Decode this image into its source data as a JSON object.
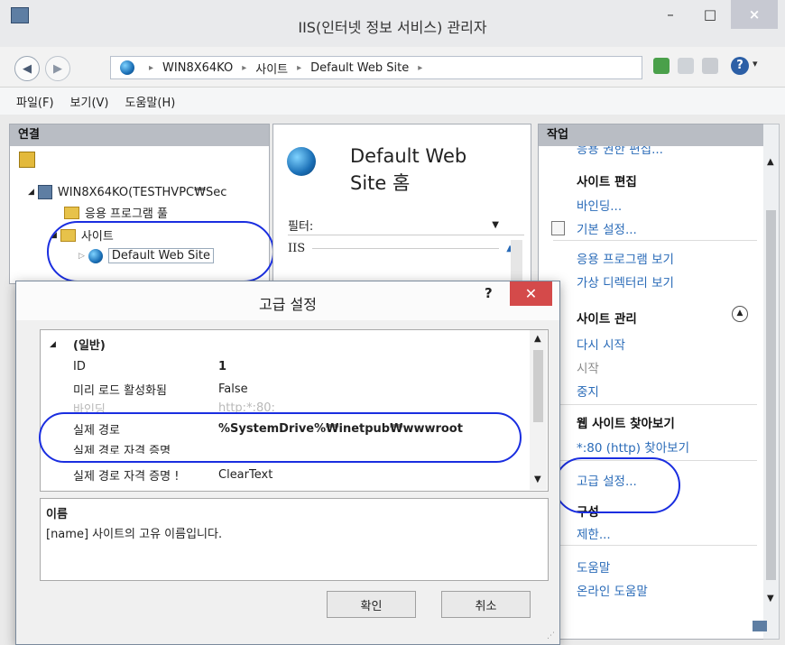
{
  "window": {
    "title": "IIS(인터넷 정보 서비스) 관리자",
    "minimize": "–",
    "maximize": "□",
    "close": "×"
  },
  "address": {
    "crumbs": [
      "WIN8X64KO",
      "사이트",
      "Default Web Site"
    ],
    "sep": "▸"
  },
  "menu": {
    "items": [
      "파일(F)",
      "보기(V)",
      "도움말(H)"
    ]
  },
  "connections": {
    "title": "연결",
    "tree": [
      {
        "label": "WIN8X64KO(TESTHVPC₩Sec"
      },
      {
        "label": "응용 프로그램 풀"
      },
      {
        "label": "사이트"
      },
      {
        "label": "Default Web Site"
      }
    ]
  },
  "center": {
    "title": "Default Web Site 홈",
    "title_line1": "Default Web",
    "title_line2": "Site 홈",
    "filter_label": "필터:",
    "group": "IIS"
  },
  "actions": {
    "title": "작업",
    "cut_item": "응용 권한 편집...",
    "site_edit_header": "사이트 편집",
    "bindings": "바인딩...",
    "basic_settings": "기본 설정...",
    "view_apps": "응용 프로그램 보기",
    "view_vdirs": "가상 디렉터리 보기",
    "manage_header": "사이트 관리",
    "restart": "다시 시작",
    "start": "시작",
    "stop": "중지",
    "browse_header": "웹 사이트 찾아보기",
    "browse_80": "*:80 (http) 찾아보기",
    "advanced": "고급 설정...",
    "config_header": "구성",
    "limits": "제한...",
    "help": "도움말",
    "online_help": "온라인 도움말"
  },
  "dialog": {
    "title": "고급 설정",
    "help": "?",
    "category": "(일반)",
    "properties": [
      {
        "name": "ID",
        "value": "1"
      },
      {
        "name": "미리 로드 활성화됨",
        "value": "False"
      },
      {
        "name": "바인딩",
        "value": "http:*:80:"
      },
      {
        "name": "실제 경로",
        "value": "%SystemDrive%₩inetpub₩wwwroot"
      },
      {
        "name": "실제 경로 자격 증명",
        "value": ""
      },
      {
        "name": "실제 경로 자격 증명 !",
        "value": "ClearText"
      }
    ],
    "desc_title": "이름",
    "desc_text": "[name] 사이트의 고유 이름입니다.",
    "ok": "확인",
    "cancel": "취소"
  }
}
